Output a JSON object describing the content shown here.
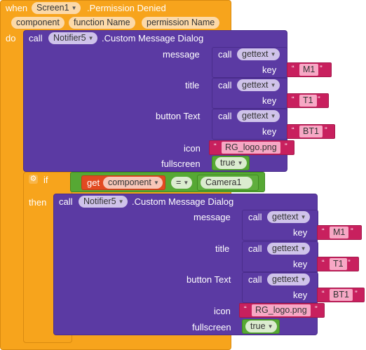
{
  "event": {
    "when_label": "when",
    "component": "Screen1",
    "event_name": ".Permission Denied",
    "params": [
      "component",
      "function Name",
      "permission Name"
    ],
    "do_label": "do"
  },
  "call1": {
    "call_label": "call",
    "component": "Notifier5",
    "method": ".Custom Message Dialog",
    "rows": [
      {
        "label": "message",
        "kind": "gettext",
        "key": "M1"
      },
      {
        "label": "title",
        "kind": "gettext",
        "key": "T1"
      },
      {
        "label": "button Text",
        "kind": "gettext",
        "key": "BT1"
      },
      {
        "label": "icon",
        "kind": "text",
        "value": "RG_logo.png"
      },
      {
        "label": "fullscreen",
        "kind": "bool",
        "value": "true"
      }
    ]
  },
  "ifblock": {
    "if_label": "if",
    "then_label": "then",
    "get_label": "get",
    "get_var": "component",
    "op": "=",
    "compare_to": "Camera1"
  },
  "call2": {
    "call_label": "call",
    "component": "Notifier5",
    "method": ".Custom Message Dialog",
    "rows": [
      {
        "label": "message",
        "kind": "gettext",
        "key": "M1"
      },
      {
        "label": "title",
        "kind": "gettext",
        "key": "T1"
      },
      {
        "label": "button Text",
        "kind": "gettext",
        "key": "BT1"
      },
      {
        "label": "icon",
        "kind": "text",
        "value": "RG_logo.png"
      },
      {
        "label": "fullscreen",
        "kind": "bool",
        "value": "true"
      }
    ]
  },
  "common": {
    "call_label": "call",
    "gettext": "gettext",
    "key_label": "key",
    "quote": "“",
    "quote_close": "”"
  },
  "colors": {
    "event": "#f7a41c",
    "procedure": "#5b3aa3",
    "text": "#c8205e",
    "logic": "#56a834",
    "variable": "#e24a21"
  }
}
